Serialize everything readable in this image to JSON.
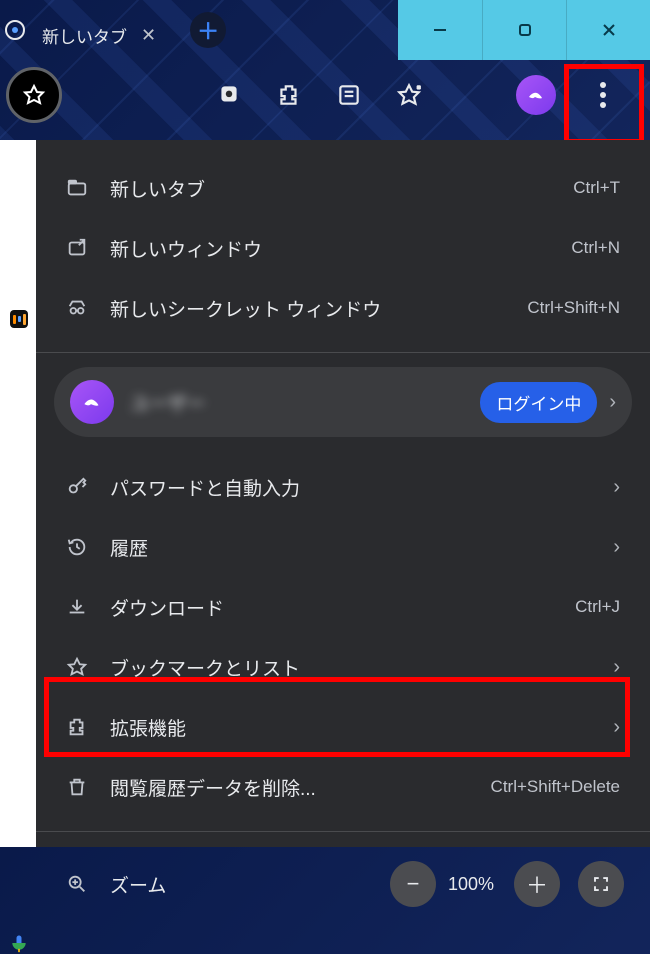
{
  "tab": {
    "title": "新しいタブ"
  },
  "menu": {
    "new_tab": {
      "label": "新しいタブ",
      "shortcut": "Ctrl+T"
    },
    "new_window": {
      "label": "新しいウィンドウ",
      "shortcut": "Ctrl+N"
    },
    "incognito": {
      "label": "新しいシークレット ウィンドウ",
      "shortcut": "Ctrl+Shift+N"
    },
    "profile": {
      "name": "ユーザー",
      "badge": "ログイン中"
    },
    "passwords": {
      "label": "パスワードと自動入力"
    },
    "history": {
      "label": "履歴"
    },
    "downloads": {
      "label": "ダウンロード",
      "shortcut": "Ctrl+J"
    },
    "bookmarks": {
      "label": "ブックマークとリスト"
    },
    "extensions": {
      "label": "拡張機能"
    },
    "clear_data": {
      "label": "閲覧履歴データを削除...",
      "shortcut": "Ctrl+Shift+Delete"
    },
    "zoom": {
      "label": "ズーム",
      "percent": "100%"
    }
  }
}
